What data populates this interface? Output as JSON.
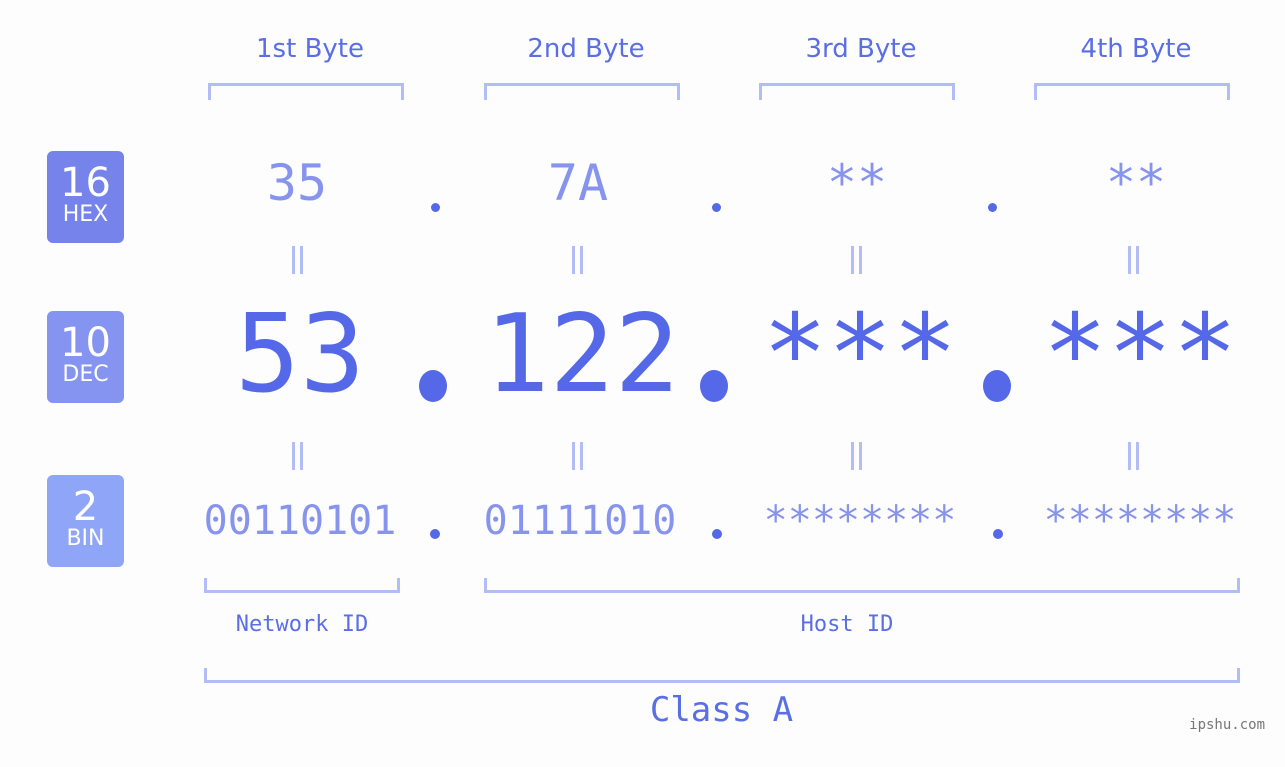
{
  "bytes": [
    {
      "header": "1st Byte",
      "hex": "35",
      "dec": "53",
      "bin": "00110101"
    },
    {
      "header": "2nd Byte",
      "hex": "7A",
      "dec": "122",
      "bin": "01111010"
    },
    {
      "header": "3rd Byte",
      "hex": "**",
      "dec": "***",
      "bin": "********"
    },
    {
      "header": "4th Byte",
      "hex": "**",
      "dec": "***",
      "bin": "********"
    }
  ],
  "badges": {
    "hex": {
      "num": "16",
      "label": "HEX",
      "color": "#7583eb"
    },
    "dec": {
      "num": "10",
      "label": "DEC",
      "color": "#8594f0"
    },
    "bin": {
      "num": "2",
      "label": "BIN",
      "color": "#8fa6f8"
    }
  },
  "equals": "=",
  "network_label": "Network ID",
  "host_label": "Host ID",
  "class_label": "Class A",
  "watermark": "ipshu.com",
  "colors": {
    "primary": "#5468e8",
    "secondary": "#8794ee",
    "bracket": "#b3bdf5"
  }
}
